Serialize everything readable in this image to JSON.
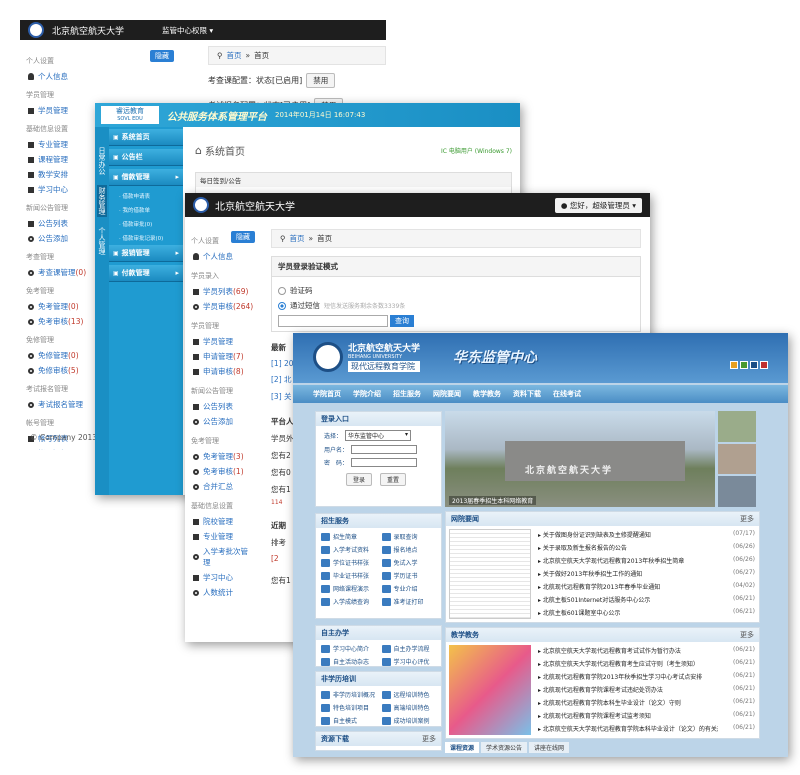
{
  "win1": {
    "brand": "北京航空航天大学",
    "menu": "监管中心权限",
    "hide_btn": "隐藏",
    "breadcrumb": [
      "首页",
      "首页"
    ],
    "row1_label": "考查课配置：状态[已启用]",
    "row1_btn": "禁用",
    "row2_label": "考试报名配置：状态[已启用]",
    "row2_btn": "禁用",
    "footer": "© Company 2013",
    "sidebar": [
      {
        "type": "section",
        "label": "个人设置"
      },
      {
        "type": "item",
        "icon": "person",
        "label": "个人信息"
      },
      {
        "type": "section",
        "label": "学员管理"
      },
      {
        "type": "item",
        "icon": "square",
        "label": "学员管理"
      },
      {
        "type": "section",
        "label": "基础信息设置"
      },
      {
        "type": "item",
        "icon": "square",
        "label": "专业管理"
      },
      {
        "type": "item",
        "icon": "square",
        "label": "课程管理"
      },
      {
        "type": "item",
        "icon": "square",
        "label": "教学安排"
      },
      {
        "type": "item",
        "icon": "square",
        "label": "学习中心"
      },
      {
        "type": "section",
        "label": "新闻公告管理"
      },
      {
        "type": "item",
        "icon": "square",
        "label": "公告列表"
      },
      {
        "type": "item",
        "icon": "dot",
        "label": "公告添加"
      },
      {
        "type": "section",
        "label": "考查管理"
      },
      {
        "type": "item",
        "icon": "dot",
        "label": "考查课管理",
        "count": "(0)"
      },
      {
        "type": "section",
        "label": "免考管理"
      },
      {
        "type": "item",
        "icon": "dot",
        "label": "免考管理",
        "count": "(0)"
      },
      {
        "type": "item",
        "icon": "dot",
        "label": "免考审核",
        "count": "(13)"
      },
      {
        "type": "section",
        "label": "免修管理"
      },
      {
        "type": "item",
        "icon": "dot",
        "label": "免修管理",
        "count": "(0)"
      },
      {
        "type": "item",
        "icon": "dot",
        "label": "免修审核",
        "count": "(5)"
      },
      {
        "type": "section",
        "label": "考试报名管理"
      },
      {
        "type": "item",
        "icon": "dot",
        "label": "考试报名管理"
      },
      {
        "type": "section",
        "label": "帐号管理"
      },
      {
        "type": "item",
        "icon": "square",
        "label": "帐号列表"
      },
      {
        "type": "item",
        "icon": "dot",
        "label": "帐号添加"
      }
    ]
  },
  "win2": {
    "logo": "睿远教育",
    "logo_sub": "SOVL EDU",
    "title": "公共服务体系管理平台",
    "datetime": "2014年01月14日 16:07:43",
    "side_tabs": [
      "日常办公",
      "财务管理",
      "个人管理"
    ],
    "menu": [
      {
        "label": "系统首页",
        "level": 0
      },
      {
        "label": "公告栏",
        "level": 0
      },
      {
        "label": "借款管理",
        "level": 0,
        "open": true
      },
      {
        "label": "借款申请表",
        "level": 1
      },
      {
        "label": "我的借款单",
        "level": 1
      },
      {
        "label": "借款审批(0)",
        "level": 1
      },
      {
        "label": "借款审批记录(0)",
        "level": 1
      },
      {
        "label": "报销管理",
        "level": 0
      },
      {
        "label": "付款管理",
        "level": 0
      }
    ],
    "page_title": "系统首页",
    "user_info": "IC 电脑用户 (Windows 7)",
    "notice_header": "每日签到/公告"
  },
  "win3": {
    "brand": "北京航空航天大学",
    "user_btn": "您好，超级管理员",
    "hide_btn": "隐藏",
    "breadcrumb": [
      "首页",
      "首页"
    ],
    "panel_title": "学员登录验证模式",
    "radio1": "验证码",
    "radio2": "通过短信",
    "radio2_note": "短信发送服务剩余条数3339条",
    "query_btn": "查询",
    "latest_title": "最新",
    "latest_items": [
      "[1] 20",
      "[2] 北",
      "[3] 关"
    ],
    "platform_title": "平台人",
    "platform_rows": [
      "学员外",
      "您有2",
      "您有0",
      "您有1"
    ],
    "platform_red": "114",
    "recent_title": "近期",
    "recent_row": "排考",
    "recent_link": "[2",
    "bottom_row": "您有1",
    "sidebar": [
      {
        "type": "section",
        "label": "个人设置"
      },
      {
        "type": "item",
        "icon": "person",
        "label": "个人信息"
      },
      {
        "type": "section",
        "label": "学员录入"
      },
      {
        "type": "item",
        "icon": "square",
        "label": "学员列表",
        "count": "(69)"
      },
      {
        "type": "item",
        "icon": "dot",
        "label": "学员审核",
        "count": "(264)"
      },
      {
        "type": "section",
        "label": "学员管理"
      },
      {
        "type": "item",
        "icon": "square",
        "label": "学员管理"
      },
      {
        "type": "item",
        "icon": "square",
        "label": "申请管理",
        "count": "(7)"
      },
      {
        "type": "item",
        "icon": "square",
        "label": "申请审核",
        "count": "(8)"
      },
      {
        "type": "section",
        "label": "新闻公告管理"
      },
      {
        "type": "item",
        "icon": "square",
        "label": "公告列表"
      },
      {
        "type": "item",
        "icon": "dot",
        "label": "公告添加"
      },
      {
        "type": "section",
        "label": "免考管理"
      },
      {
        "type": "item",
        "icon": "dot",
        "label": "免考管理",
        "count": "(3)"
      },
      {
        "type": "item",
        "icon": "dot",
        "label": "免考审核",
        "count": "(1)"
      },
      {
        "type": "item",
        "icon": "dot",
        "label": "合并汇总"
      },
      {
        "type": "section",
        "label": "基础信息设置"
      },
      {
        "type": "item",
        "icon": "square",
        "label": "院校管理"
      },
      {
        "type": "item",
        "icon": "square",
        "label": "专业管理"
      },
      {
        "type": "item",
        "icon": "dot",
        "label": "入学考批次管理"
      },
      {
        "type": "item",
        "icon": "square",
        "label": "学习中心"
      },
      {
        "type": "item",
        "icon": "dot",
        "label": "人数统计"
      }
    ]
  },
  "win4": {
    "school_en": "BEIHANG UNIVERSITY",
    "school_cn": "北京航空航天大学",
    "school_sub": "现代远程教育学院",
    "center": "华东监管中心",
    "nav": [
      "学院首页",
      "学院介绍",
      "招生服务",
      "网院要闻",
      "教学教务",
      "资料下载",
      "在线考试"
    ],
    "login_title": "登录入口",
    "login_select_label": "选择：",
    "login_select_value": "华东监管中心",
    "login_user_label": "用户名：",
    "login_pwd_label": "密　码：",
    "login_btn": "登录",
    "reset_btn": "重置",
    "banner_caption": "北京航空航天大学",
    "banner_sub": "2013届春季招生本科网络教育",
    "services_title": "招生服务",
    "services": [
      "招生简章",
      "录取查询",
      "入学考试资料",
      "报名地点",
      "学位证书样张",
      "免试入学",
      "毕业证书样张",
      "学历证书",
      "网络课程演示",
      "专业介绍",
      "入学成绩查询",
      "准考证打印"
    ],
    "study_title": "自主办学",
    "study": [
      "学习中心简介",
      "自主办学流程",
      "自主活动杂志",
      "学习中心评优"
    ],
    "nonedu_title": "非学历培训",
    "nonedu": [
      "非学历培训概况",
      "远程培训特色",
      "特色培训项目",
      "高端培训特色",
      "自主模式",
      "成功培训案例"
    ],
    "download_title": "资源下载",
    "news_title": "网院要闻",
    "more": "更多",
    "news": [
      {
        "t": "关于做图身份证识别缺表及主修提醒通知",
        "d": "(07/17)"
      },
      {
        "t": "关于录取及新生报名报告的公告",
        "d": "(06/26)"
      },
      {
        "t": "北京航空航天大学现代远程教育2013年秋季招生简章",
        "d": "(06/26)"
      },
      {
        "t": "关于做好2013年秋季招生工作的通知",
        "d": "(06/27)"
      },
      {
        "t": "北航现代远程教育学院2013年春季毕业通知",
        "d": "(04/02)"
      },
      {
        "t": "北航主板501Internet对话服务中心公示",
        "d": "(06/21)"
      },
      {
        "t": "北航主板601课题室中心公示",
        "d": "(06/21)"
      }
    ],
    "teach_title": "教学教务",
    "teach": [
      {
        "t": "北京航空航天大学现代远程教育考试试作为暂行办法",
        "d": "(06/21)"
      },
      {
        "t": "北京航空航天大学现代远程教育考生应试守则（考生须知）",
        "d": "(06/21)"
      },
      {
        "t": "北航现代远程教育学院2013年秋季招生学习中心考试点安排",
        "d": "(06/21)"
      },
      {
        "t": "北航现代远程教育学院课程考试违纪处罚办法",
        "d": "(06/21)"
      },
      {
        "t": "北航现代远程教育学院本科生毕业设计（论文）守则",
        "d": "(06/21)"
      },
      {
        "t": "北航现代远程教育学院课程考试监考须知",
        "d": "(06/21)"
      },
      {
        "t": "北京航空航天大学现代远程教育学院本科毕业设计（论文）的有关规定（修订）",
        "d": "(06/21)"
      }
    ],
    "bottom_tabs": [
      "课程资源",
      "学术资源公告",
      "讲座在线网"
    ],
    "colors": [
      "#e8a020",
      "#4a9a30",
      "#1d4f86",
      "#c03030"
    ]
  }
}
